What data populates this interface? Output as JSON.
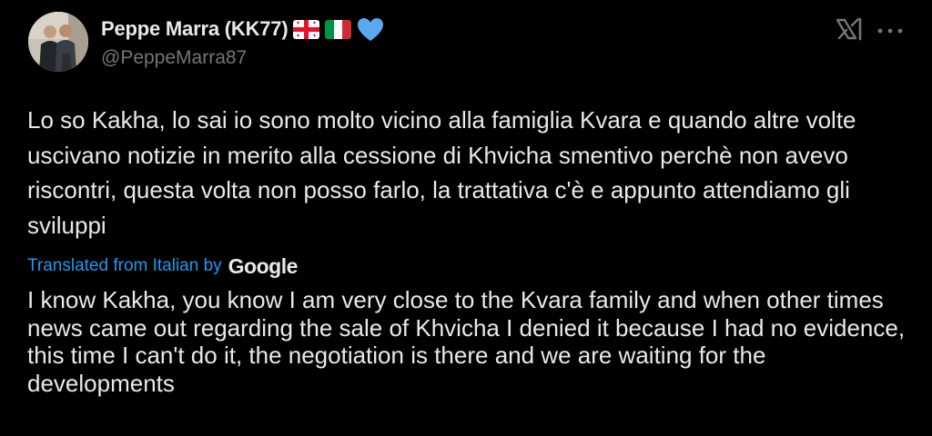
{
  "author": {
    "display_name": "Peppe Marra (KK77)",
    "handle": "@PeppeMarra87",
    "badges": [
      "georgia-flag-icon",
      "italy-flag-icon",
      "blue-heart-icon"
    ]
  },
  "header_icons": {
    "grok": "grok-icon",
    "more": "more-options-icon"
  },
  "tweet": {
    "text": "Lo so Kakha, lo sai io sono molto vicino alla famiglia Kvara e quando altre volte uscivano notizie in merito alla cessione di Khvicha smentivo perchè non avevo riscontri, questa volta non posso farlo, la trattativa c'è e appunto attendiamo gli sviluppi"
  },
  "translation": {
    "label": "Translated from Italian by",
    "provider": "Google",
    "text": "I know Kakha, you know I am very close to the Kvara family and when other times news came out regarding the sale of Khvicha I denied it because I had no evidence, this time I can't do it, the negotiation is there and we are waiting for the developments"
  },
  "colors": {
    "background": "#000000",
    "text": "#e7e9ea",
    "muted": "#71767b",
    "link": "#1d9bf0",
    "heart": "#5ba8f0"
  }
}
